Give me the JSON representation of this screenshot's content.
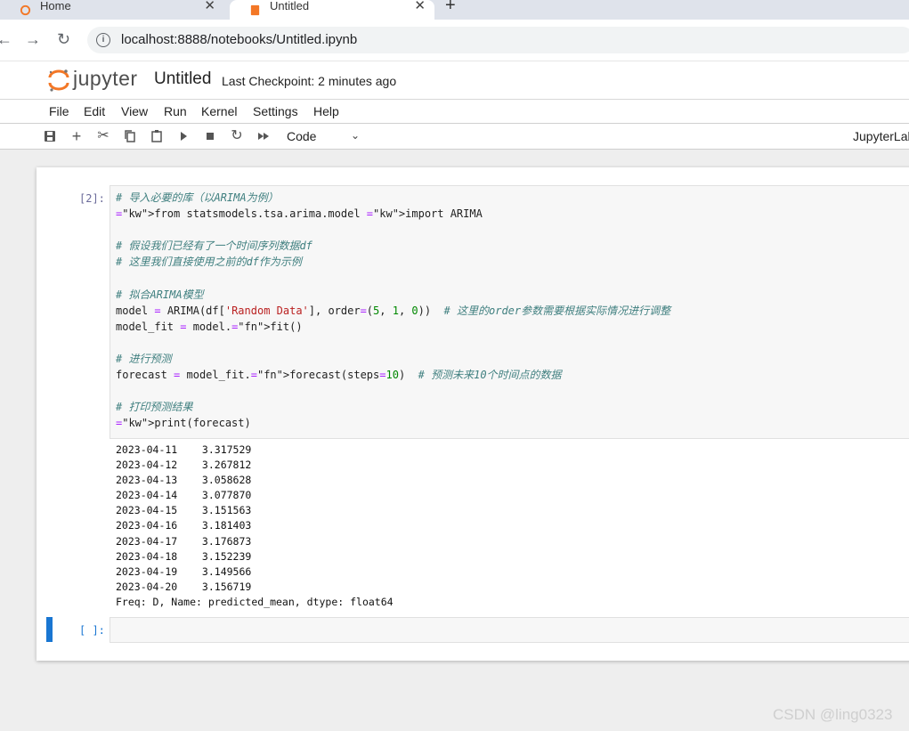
{
  "browser": {
    "tabs": [
      {
        "label": "Home"
      },
      {
        "label": "Untitled"
      }
    ],
    "url": "localhost:8888/notebooks/Untitled.ipynb"
  },
  "header": {
    "logo_text": "jupyter",
    "notebook_title": "Untitled",
    "checkpoint": "Last Checkpoint: 2 minutes ago"
  },
  "menu": [
    "File",
    "Edit",
    "View",
    "Run",
    "Kernel",
    "Settings",
    "Help"
  ],
  "toolbar": {
    "cell_type": "Code",
    "right_label": "JupyterLab"
  },
  "cells": [
    {
      "prompt": "[2]:",
      "code_lines": [
        "# 导入必要的库（以ARIMA为例）",
        "from statsmodels.tsa.arima.model import ARIMA",
        "",
        "# 假设我们已经有了一个时间序列数据df",
        "# 这里我们直接使用之前的df作为示例",
        "",
        "# 拟合ARIMA模型",
        "model = ARIMA(df['Random Data'], order=(5, 1, 0))  # 这里的order参数需要根据实际情况进行调整",
        "model_fit = model.fit()",
        "",
        "# 进行预测",
        "forecast = model_fit.forecast(steps=10)  # 预测未来10个时间点的数据",
        "",
        "# 打印预测结果",
        "print(forecast)"
      ],
      "output_lines": [
        "2023-04-11    3.317529",
        "2023-04-12    3.267812",
        "2023-04-13    3.058628",
        "2023-04-14    3.077870",
        "2023-04-15    3.151563",
        "2023-04-16    3.181403",
        "2023-04-17    3.176873",
        "2023-04-18    3.152239",
        "2023-04-19    3.149566",
        "2023-04-20    3.156719",
        "Freq: D, Name: predicted_mean, dtype: float64"
      ]
    },
    {
      "prompt": "[ ]:"
    }
  ],
  "watermark": "CSDN @ling0323"
}
